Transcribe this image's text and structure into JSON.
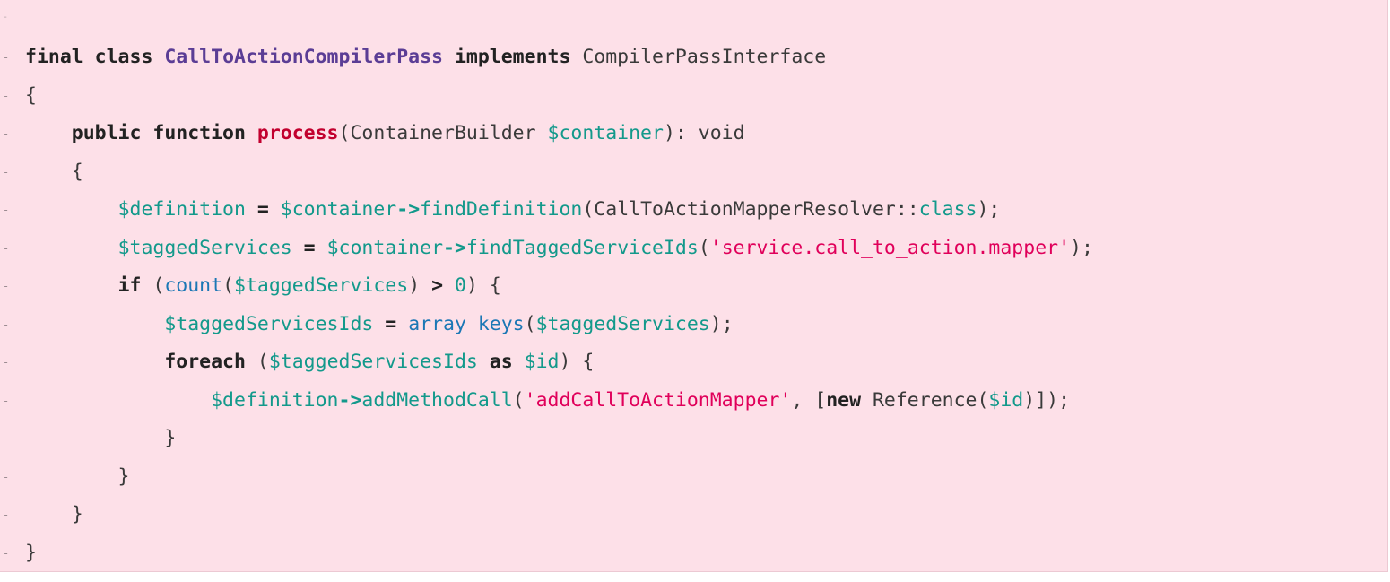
{
  "colors": {
    "background": "#fde0e8",
    "keyword": "#222222",
    "class_name": "#5b3d95",
    "function_name": "#c2002e",
    "variable": "#13998b",
    "builtin": "#1b77b5",
    "string": "#e0005a",
    "plain": "#3a3a3a"
  },
  "diff": {
    "top_marker": "-",
    "lines": [
      {
        "marker": "-",
        "tokens": [
          {
            "t": "final class ",
            "k": "kw"
          },
          {
            "t": "CallToActionCompilerPass",
            "k": "class"
          },
          {
            "t": " implements",
            "k": "kw"
          },
          {
            "t": " CompilerPassInterface",
            "k": "type"
          }
        ]
      },
      {
        "marker": "-",
        "tokens": [
          {
            "t": "{",
            "k": "punct"
          }
        ]
      },
      {
        "marker": "-",
        "tokens": [
          {
            "t": "    public function ",
            "k": "kw"
          },
          {
            "t": "process",
            "k": "fn"
          },
          {
            "t": "(ContainerBuilder ",
            "k": "type"
          },
          {
            "t": "$container",
            "k": "var"
          },
          {
            "t": "): void",
            "k": "plain"
          }
        ]
      },
      {
        "marker": "-",
        "tokens": [
          {
            "t": "    {",
            "k": "punct"
          }
        ]
      },
      {
        "marker": "-",
        "tokens": [
          {
            "t": "        ",
            "k": "plain"
          },
          {
            "t": "$definition",
            "k": "var"
          },
          {
            "t": " = ",
            "k": "kw"
          },
          {
            "t": "$container",
            "k": "var"
          },
          {
            "t": "->",
            "k": "op"
          },
          {
            "t": "findDefinition",
            "k": "method"
          },
          {
            "t": "(CallToActionMapperResolver::",
            "k": "type"
          },
          {
            "t": "class",
            "k": "method"
          },
          {
            "t": ");",
            "k": "punct"
          }
        ]
      },
      {
        "marker": "-",
        "tokens": [
          {
            "t": "        ",
            "k": "plain"
          },
          {
            "t": "$taggedServices",
            "k": "var"
          },
          {
            "t": " = ",
            "k": "kw"
          },
          {
            "t": "$container",
            "k": "var"
          },
          {
            "t": "->",
            "k": "op"
          },
          {
            "t": "findTaggedServiceIds",
            "k": "method"
          },
          {
            "t": "(",
            "k": "punct"
          },
          {
            "t": "'service.call_to_action.mapper'",
            "k": "str"
          },
          {
            "t": ");",
            "k": "punct"
          }
        ]
      },
      {
        "marker": "-",
        "tokens": [
          {
            "t": "        if",
            "k": "kw"
          },
          {
            "t": " (",
            "k": "punct"
          },
          {
            "t": "count",
            "k": "builtin"
          },
          {
            "t": "(",
            "k": "punct"
          },
          {
            "t": "$taggedServices",
            "k": "var"
          },
          {
            "t": ") ",
            "k": "punct"
          },
          {
            "t": ">",
            "k": "kw"
          },
          {
            "t": " ",
            "k": "plain"
          },
          {
            "t": "0",
            "k": "num"
          },
          {
            "t": ") {",
            "k": "punct"
          }
        ]
      },
      {
        "marker": "-",
        "tokens": [
          {
            "t": "            ",
            "k": "plain"
          },
          {
            "t": "$taggedServicesIds",
            "k": "var"
          },
          {
            "t": " = ",
            "k": "kw"
          },
          {
            "t": "array_keys",
            "k": "builtin"
          },
          {
            "t": "(",
            "k": "punct"
          },
          {
            "t": "$taggedServices",
            "k": "var"
          },
          {
            "t": ");",
            "k": "punct"
          }
        ]
      },
      {
        "marker": "-",
        "tokens": [
          {
            "t": "            foreach",
            "k": "kw"
          },
          {
            "t": " (",
            "k": "punct"
          },
          {
            "t": "$taggedServicesIds",
            "k": "var"
          },
          {
            "t": " as ",
            "k": "kw"
          },
          {
            "t": "$id",
            "k": "var"
          },
          {
            "t": ") {",
            "k": "punct"
          }
        ]
      },
      {
        "marker": "-",
        "tokens": [
          {
            "t": "                ",
            "k": "plain"
          },
          {
            "t": "$definition",
            "k": "var"
          },
          {
            "t": "->",
            "k": "op"
          },
          {
            "t": "addMethodCall",
            "k": "method"
          },
          {
            "t": "(",
            "k": "punct"
          },
          {
            "t": "'addCallToActionMapper'",
            "k": "str"
          },
          {
            "t": ", [",
            "k": "punct"
          },
          {
            "t": "new",
            "k": "kw"
          },
          {
            "t": " Reference(",
            "k": "type"
          },
          {
            "t": "$id",
            "k": "var"
          },
          {
            "t": ")]);",
            "k": "punct"
          }
        ]
      },
      {
        "marker": "-",
        "tokens": [
          {
            "t": "            }",
            "k": "punct"
          }
        ]
      },
      {
        "marker": "-",
        "tokens": [
          {
            "t": "        }",
            "k": "punct"
          }
        ]
      },
      {
        "marker": "-",
        "tokens": [
          {
            "t": "    }",
            "k": "punct"
          }
        ]
      },
      {
        "marker": "-",
        "tokens": [
          {
            "t": "}",
            "k": "punct"
          }
        ]
      }
    ]
  }
}
